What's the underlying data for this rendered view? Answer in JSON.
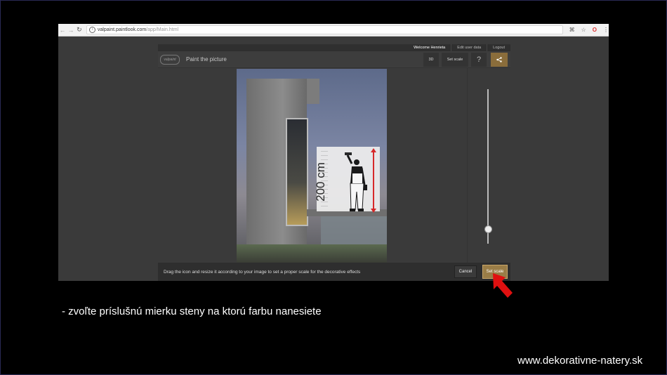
{
  "browser": {
    "url_host": "valpaint.paintlook.com",
    "url_path": "/app/Main.html"
  },
  "app": {
    "logo": "valpaint",
    "title": "Paint the picture",
    "user": {
      "welcome": "Welcome Henrieta",
      "edit": "Edit user data",
      "logout": "Logout"
    },
    "toolbar": {
      "btn_3d": "3D",
      "btn_scale": "Set scale",
      "help": "?"
    },
    "scale_label": "200 cm",
    "hint": "Drag the icon and resize it according to your image to set a proper scale for the decorative effects",
    "cancel": "Cancel",
    "set_scale": "Set scale",
    "slider_value": 0.1
  },
  "slide": {
    "caption": "- zvoľte príslušnú mierku steny na ktorú farbu nanesiete",
    "website": "www.dekorativne-natery.sk"
  },
  "colors": {
    "accent": "#9a7d47",
    "arrow": "#d22222"
  }
}
